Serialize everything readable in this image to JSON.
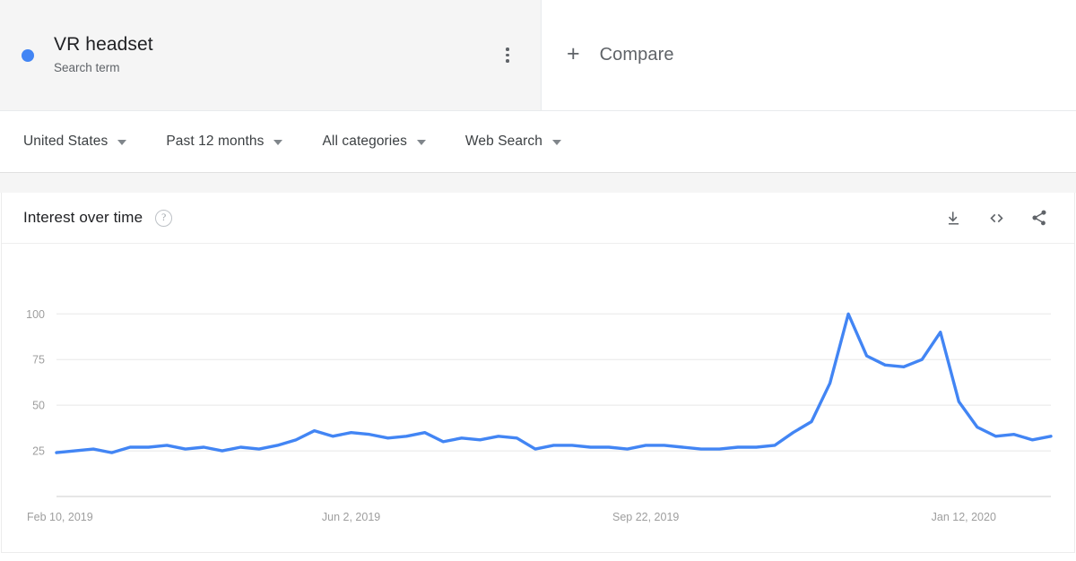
{
  "term": {
    "title": "VR headset",
    "subtitle": "Search term",
    "dot_color": "#4285f4",
    "menu_icon": "more-vert-icon"
  },
  "compare": {
    "label": "Compare",
    "plus_icon": "plus-icon",
    "plus_glyph": "+"
  },
  "filters": [
    {
      "label": "United States",
      "icon": "chevron-down-icon"
    },
    {
      "label": "Past 12 months",
      "icon": "chevron-down-icon"
    },
    {
      "label": "All categories",
      "icon": "chevron-down-icon"
    },
    {
      "label": "Web Search",
      "icon": "chevron-down-icon"
    }
  ],
  "card": {
    "title": "Interest over time",
    "help_icon": "help-circle-icon",
    "help_glyph": "?",
    "actions": [
      {
        "name": "download-icon",
        "title": "Download"
      },
      {
        "name": "embed-code-icon",
        "title": "Embed"
      },
      {
        "name": "share-icon",
        "title": "Share"
      }
    ]
  },
  "chart_data": {
    "type": "line",
    "title": "Interest over time",
    "xlabel": "",
    "ylabel": "",
    "ylim": [
      0,
      108
    ],
    "yticks": [
      25,
      50,
      75,
      100
    ],
    "ytick_labels": [
      "25",
      "50",
      "75",
      "100"
    ],
    "grid": true,
    "legend": "none",
    "line_color": "#4285f4",
    "xtick_labels": [
      "Feb 10, 2019",
      "Jun 2, 2019",
      "Sep 22, 2019",
      "Jan 12, 2020"
    ],
    "xtick_indices": [
      0,
      16,
      32,
      48
    ],
    "series": [
      {
        "name": "VR headset",
        "color": "#4285f4",
        "values": [
          24,
          25,
          26,
          24,
          27,
          27,
          28,
          26,
          27,
          25,
          27,
          26,
          28,
          31,
          36,
          33,
          35,
          34,
          32,
          33,
          35,
          30,
          32,
          31,
          33,
          32,
          26,
          28,
          28,
          27,
          27,
          26,
          28,
          28,
          27,
          26,
          26,
          27,
          27,
          28,
          35,
          41,
          62,
          100,
          77,
          72,
          71,
          75,
          90,
          52,
          38,
          33,
          34,
          31,
          33
        ]
      }
    ]
  }
}
